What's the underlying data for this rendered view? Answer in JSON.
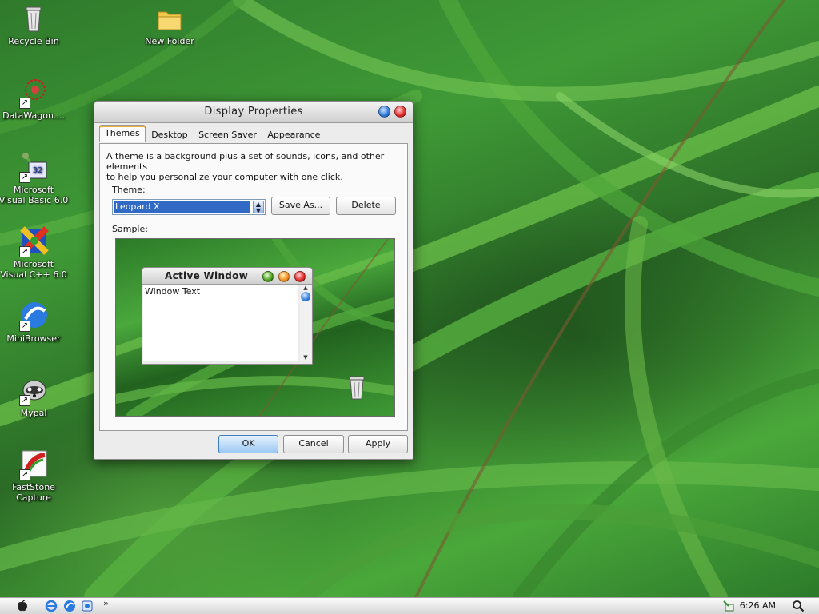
{
  "desktop": {
    "icons": [
      {
        "label": "Recycle Bin",
        "icon": "recycle-bin-icon",
        "shortcut": false
      },
      {
        "label": "New Folder",
        "icon": "folder-icon",
        "shortcut": false
      },
      {
        "label": "DataWagon....",
        "icon": "datawagon-icon",
        "shortcut": true
      },
      {
        "label_lines": [
          "Microsoft",
          "Visual Basic 6.0"
        ],
        "icon": "visual-basic-icon",
        "shortcut": true
      },
      {
        "label_lines": [
          "Microsoft",
          "Visual C++ 6.0"
        ],
        "icon": "visual-cpp-icon",
        "shortcut": true
      },
      {
        "label": "MiniBrowser",
        "icon": "minibrowser-icon",
        "shortcut": true
      },
      {
        "label": "Mypal",
        "icon": "mypal-icon",
        "shortcut": true
      },
      {
        "label_lines": [
          "FastStone",
          "Capture"
        ],
        "icon": "faststone-capture-icon",
        "shortcut": true
      }
    ]
  },
  "dialog": {
    "title": "Display Properties",
    "tabs": [
      {
        "label": "Themes",
        "active": true
      },
      {
        "label": "Desktop",
        "active": false
      },
      {
        "label": "Screen Saver",
        "active": false
      },
      {
        "label": "Appearance",
        "active": false
      }
    ],
    "description_line1": "A theme is a background plus a set of sounds, icons, and other elements",
    "description_line2": "to help you personalize your computer with one click.",
    "theme_label": "Theme:",
    "theme_value": "Leopard X",
    "save_as_label": "Save As...",
    "delete_label": "Delete",
    "sample_label": "Sample:",
    "sample": {
      "window_title": "Active Window",
      "window_text": "Window Text"
    },
    "ok_label": "OK",
    "cancel_label": "Cancel",
    "apply_label": "Apply"
  },
  "taskbar": {
    "clock": "6:26 AM",
    "overflow": "»"
  },
  "colors": {
    "selection": "#316ac5",
    "title_close": "#e02a2a",
    "title_maximize": "#2f78d8",
    "ok_button": "#9cc8f2"
  }
}
